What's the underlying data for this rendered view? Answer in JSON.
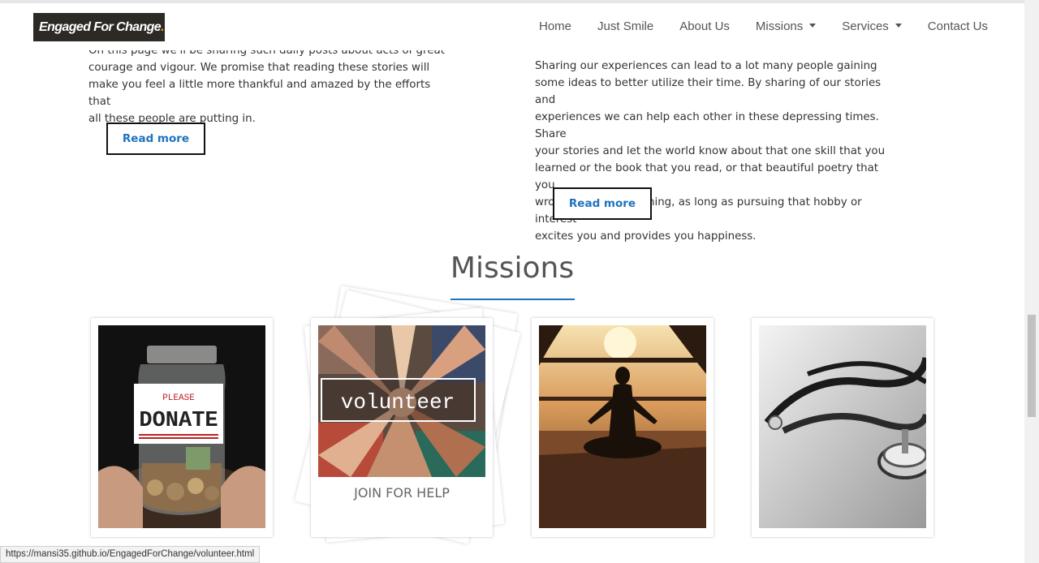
{
  "navbar": {
    "brand": "Engaged For Change",
    "brand_dot": ".",
    "items": [
      {
        "label": "Home"
      },
      {
        "label": "Just Smile"
      },
      {
        "label": "About Us"
      },
      {
        "label": "Missions",
        "dropdown": true
      },
      {
        "label": "Services",
        "dropdown": true
      },
      {
        "label": "Contact Us"
      }
    ]
  },
  "stories": {
    "left_lines": [
      "On this page we'll be sharing such daily posts about acts of great",
      "courage and vigour. We promise that reading these stories will",
      "make you feel a little more thankful and amazed by the efforts that",
      "all these people are putting in."
    ],
    "right_lines": [
      "Sharing our experiences can lead to a lot many people gaining",
      "some ideas to better utilize their time. By sharing of our stories and",
      "experiences we can help each other in these depressing times. Share",
      "your stories and let the world know about that one skill that you",
      "learned or the book that you read, or that beautiful poetry that you",
      "wrote. It can be anything, as long as pursuing that hobby or interest",
      "excites you and provides you happiness."
    ],
    "read_more_label": "Read more"
  },
  "missions": {
    "title": "Missions",
    "cards": [
      {
        "image_text_small": "PLEASE",
        "image_text_big": "DONATE"
      },
      {
        "image_text": "volunteer",
        "caption": "JOIN FOR HELP"
      },
      {},
      {}
    ]
  },
  "status_bar": {
    "url": "https://mansi35.github.io/EngagedForChange/volunteer.html"
  },
  "colors": {
    "accent": "#1e73be",
    "brand_bg": "#2d2a26",
    "brand_dot": "#e0a800"
  }
}
